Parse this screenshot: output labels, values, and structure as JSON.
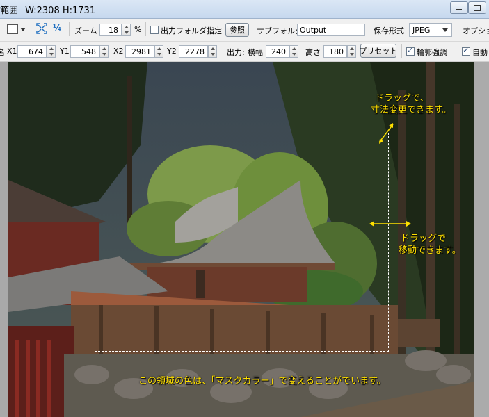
{
  "window": {
    "title_prefix": "範囲",
    "size_label": "W:2308 H:1731"
  },
  "toolbar1": {
    "zoom_label": "ズーム",
    "zoom_value": "18",
    "zoom_unit": "%",
    "output_folder_label": "出力フォルダ指定",
    "browse_button": "参照",
    "subfolder_label": "サブフォルダ",
    "subfolder_value": "Output",
    "save_format_label": "保存形式",
    "save_format_value": "JPEG",
    "options_label": "オプショ"
  },
  "toolbar2": {
    "lead_label": "名",
    "x1_label": "X1",
    "x1_value": "674",
    "y1_label": "Y1",
    "y1_value": "548",
    "x2_label": "X2",
    "x2_value": "2981",
    "y2_label": "Y2",
    "y2_value": "2278",
    "output_label": "出力:",
    "width_label": "横幅",
    "width_value": "240",
    "height_label": "高さ",
    "height_value": "180",
    "preset_button": "プリセット",
    "edge_enhance_label": "輪郭強調",
    "auto_label": "自動"
  },
  "annotations": {
    "resize_line1": "ドラッグで、",
    "resize_line2": "寸法変更できます。",
    "move_line1": "ドラッグで",
    "move_line2": "移動できます。",
    "mask_note": "この領域の色は、「マスクカラー」で変えることがでいます。"
  },
  "colors": {
    "annotation": "#ffe000",
    "selection_border": "#ffffff",
    "canvas_bg": "#a9a9a9"
  }
}
